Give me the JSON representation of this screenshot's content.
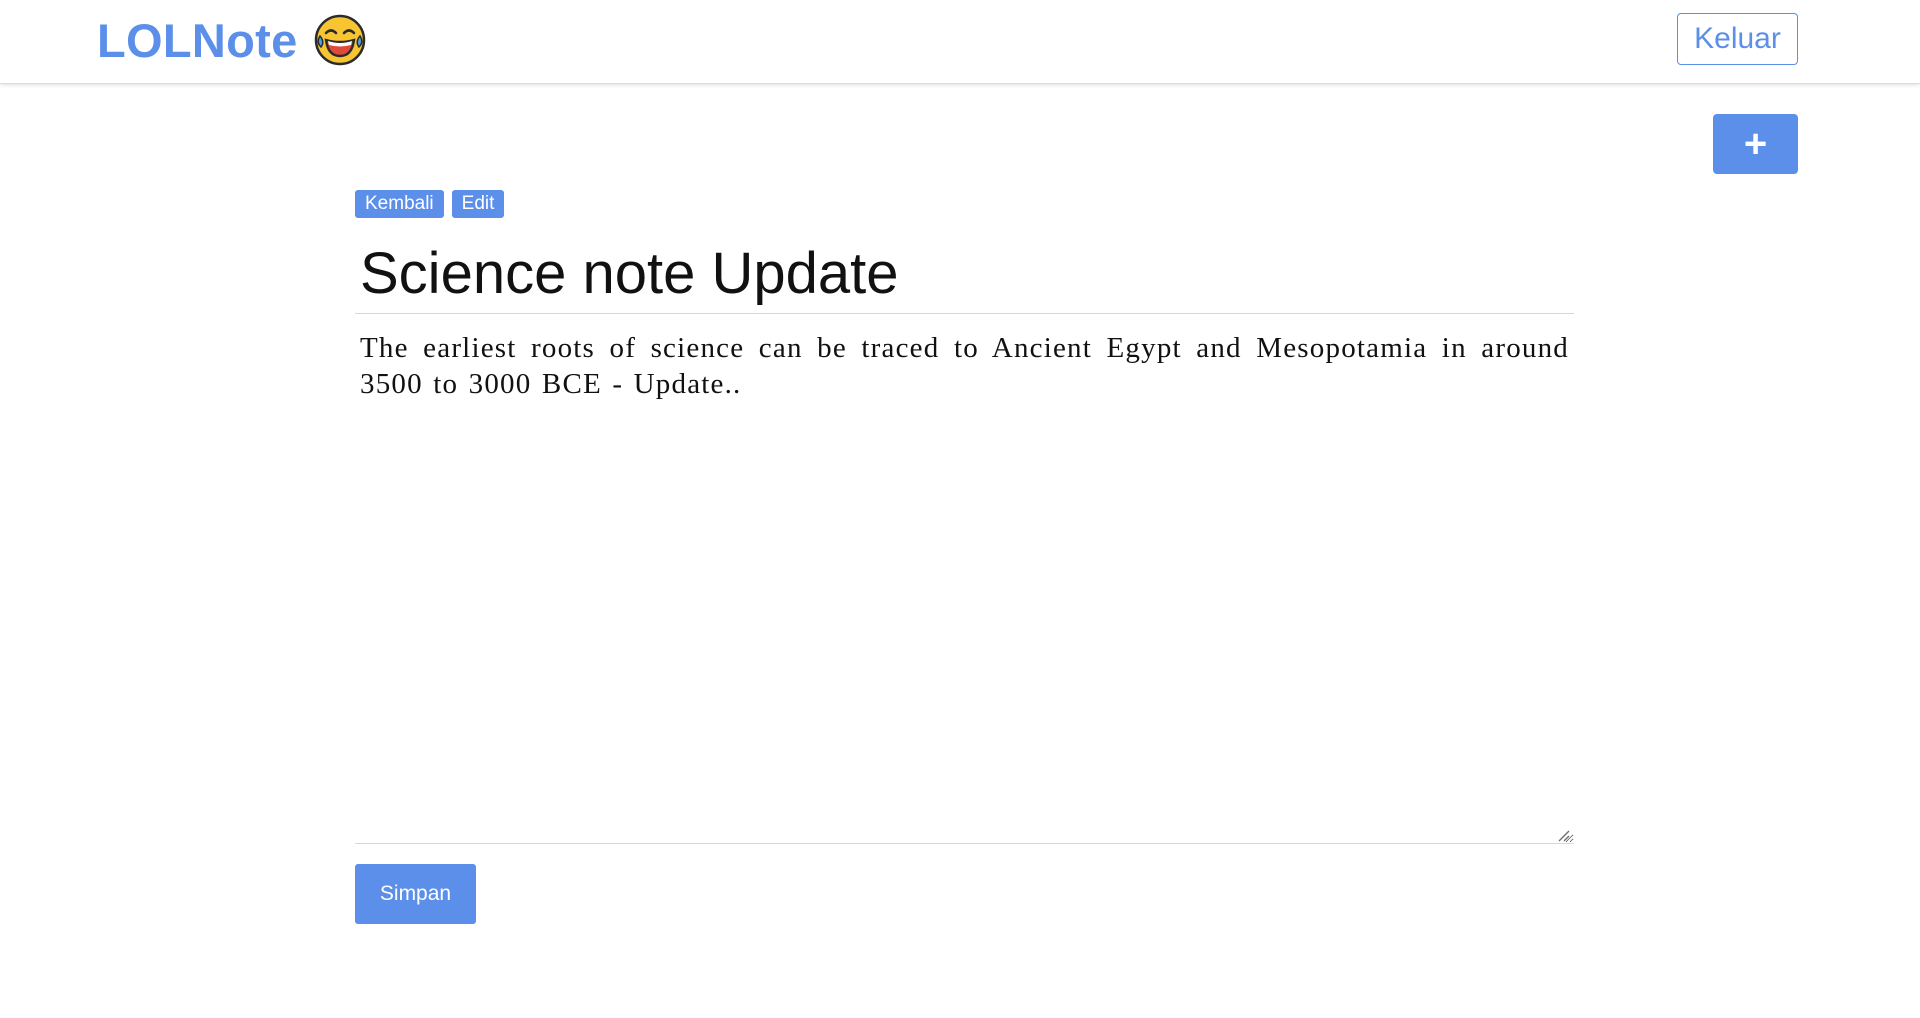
{
  "navbar": {
    "brand_text": "LOLNote",
    "brand_icon": "face-with-tears-of-joy-emoji",
    "logout_label": "Keluar"
  },
  "toolbar": {
    "add_label": "+",
    "back_label": "Kembali",
    "edit_label": "Edit"
  },
  "note": {
    "title": "Science note Update",
    "body": "The earliest roots of science can be traced to Ancient Egypt and Mesopotamia in around 3500 to 3000 BCE - Update.."
  },
  "form": {
    "save_label": "Simpan"
  },
  "colors": {
    "accent": "#5b8fea",
    "border": "#d7d7d7",
    "text": "#111111"
  }
}
